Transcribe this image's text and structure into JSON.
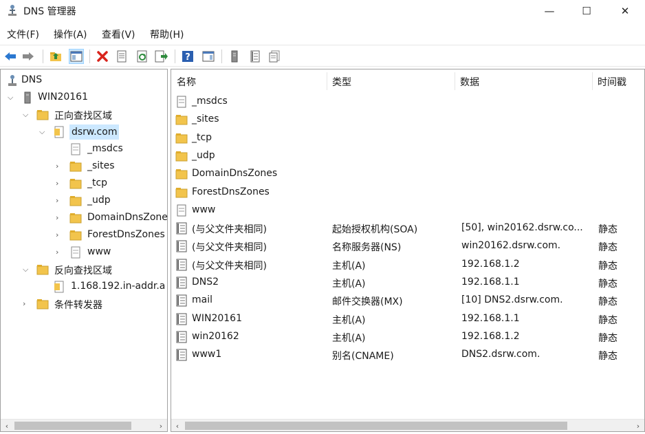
{
  "window": {
    "title": "DNS 管理器",
    "min_glyph": "—",
    "max_glyph": "☐",
    "close_glyph": "✕"
  },
  "menu": [
    "文件(F)",
    "操作(A)",
    "查看(V)",
    "帮助(H)"
  ],
  "toolbar": [
    "back-icon",
    "forward-icon",
    "up-folder-icon",
    "show-hide-tree-icon",
    "delete-icon",
    "properties-icon",
    "refresh-icon",
    "export-list-icon",
    "help-icon",
    "show-hide-action-pane-icon",
    "server-icon",
    "record-list-icon",
    "zone-icon"
  ],
  "tree": {
    "root": "DNS",
    "server": "WIN20161",
    "forward_zones": "正向查找区域",
    "zone": "dsrw.com",
    "children": [
      "_msdcs",
      "_sites",
      "_tcp",
      "_udp",
      "DomainDnsZones",
      "ForestDnsZones",
      "www"
    ],
    "reverse_zones": "反向查找区域",
    "reverse_zone": "1.168.192.in-addr.a",
    "conditional": "条件转发器"
  },
  "columns": [
    "名称",
    "类型",
    "数据",
    "时间戳"
  ],
  "records": [
    {
      "name": "_msdcs",
      "type": "",
      "data": "",
      "ts": "",
      "icon": "zone-doc-icon"
    },
    {
      "name": "_sites",
      "type": "",
      "data": "",
      "ts": "",
      "icon": "folder-icon"
    },
    {
      "name": "_tcp",
      "type": "",
      "data": "",
      "ts": "",
      "icon": "folder-icon"
    },
    {
      "name": "_udp",
      "type": "",
      "data": "",
      "ts": "",
      "icon": "folder-icon"
    },
    {
      "name": "DomainDnsZones",
      "type": "",
      "data": "",
      "ts": "",
      "icon": "folder-icon"
    },
    {
      "name": "ForestDnsZones",
      "type": "",
      "data": "",
      "ts": "",
      "icon": "folder-icon"
    },
    {
      "name": "www",
      "type": "",
      "data": "",
      "ts": "",
      "icon": "zone-doc-icon"
    },
    {
      "name": "(与父文件夹相同)",
      "type": "起始授权机构(SOA)",
      "data": "[50], win20162.dsrw.co...",
      "ts": "静态",
      "icon": "record-icon"
    },
    {
      "name": "(与父文件夹相同)",
      "type": "名称服务器(NS)",
      "data": "win20162.dsrw.com.",
      "ts": "静态",
      "icon": "record-icon"
    },
    {
      "name": "(与父文件夹相同)",
      "type": "主机(A)",
      "data": "192.168.1.2",
      "ts": "静态",
      "icon": "record-icon"
    },
    {
      "name": "DNS2",
      "type": "主机(A)",
      "data": "192.168.1.1",
      "ts": "静态",
      "icon": "record-icon"
    },
    {
      "name": "mail",
      "type": "邮件交换器(MX)",
      "data": "[10]  DNS2.dsrw.com.",
      "ts": "静态",
      "icon": "record-icon"
    },
    {
      "name": "WIN20161",
      "type": "主机(A)",
      "data": "192.168.1.1",
      "ts": "静态",
      "icon": "record-icon"
    },
    {
      "name": "win20162",
      "type": "主机(A)",
      "data": "192.168.1.2",
      "ts": "静态",
      "icon": "record-icon"
    },
    {
      "name": "www1",
      "type": "别名(CNAME)",
      "data": "DNS2.dsrw.com.",
      "ts": "静态",
      "icon": "record-icon"
    }
  ],
  "colors": {
    "selection": "#cce8ff",
    "folder": "#f2c44c",
    "delete": "#d9241c",
    "arrow": "#2b78d0"
  }
}
